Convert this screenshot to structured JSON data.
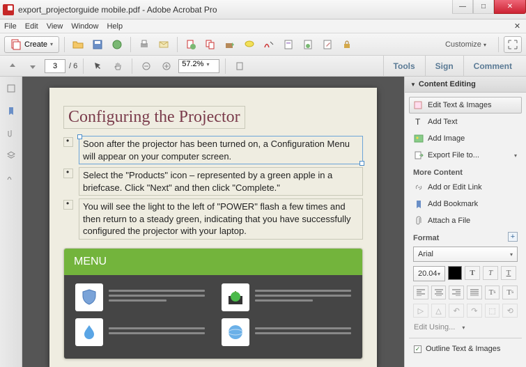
{
  "window": {
    "title": "export_projectorguide mobile.pdf - Adobe Acrobat Pro"
  },
  "menubar": [
    "File",
    "Edit",
    "View",
    "Window",
    "Help"
  ],
  "toolbar": {
    "create": "Create",
    "customize": "Customize"
  },
  "nav": {
    "page": "3",
    "page_total": "/ 6",
    "zoom": "57.2%"
  },
  "tabs": {
    "tools": "Tools",
    "sign": "Sign",
    "comment": "Comment"
  },
  "doc": {
    "heading": "Configuring the Projector",
    "bullets": [
      "Soon after the projector has been turned on, a Configuration Menu will appear on your computer screen.",
      "Select the \"Products\" icon – represented by a green apple in a briefcase. Click \"Next\" and then click \"Complete.\"",
      "You will see the light to the left of \"POWER\" flash a few times and then return to a steady green, indicating that you have successfully configured the projector with your laptop."
    ],
    "menu_label": "MENU"
  },
  "panel": {
    "title": "Content Editing",
    "edit_text_images": "Edit Text & Images",
    "add_text": "Add Text",
    "add_image": "Add Image",
    "export_file": "Export File to...",
    "more_content": "More Content",
    "add_link": "Add or Edit Link",
    "add_bookmark": "Add Bookmark",
    "attach_file": "Attach a File",
    "format": "Format",
    "font": "Arial",
    "size": "20.04",
    "edit_using": "Edit Using...",
    "outline": "Outline Text & Images"
  }
}
